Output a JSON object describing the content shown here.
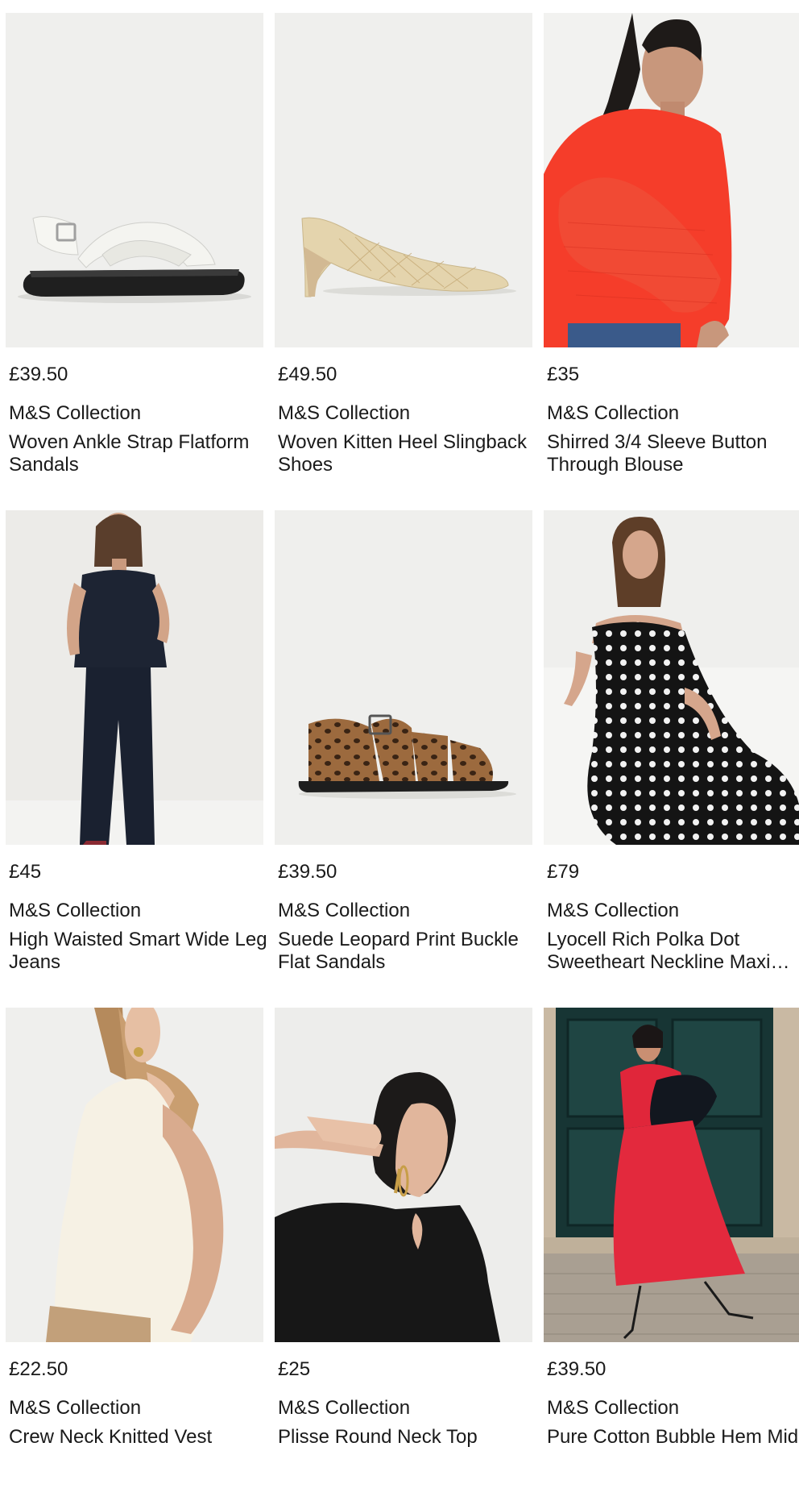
{
  "products": [
    {
      "price": "£39.50",
      "brand": "M&S Collection",
      "name": "Woven Ankle Strap Flatform Sandals",
      "image": "white-woven-flatform-sandal"
    },
    {
      "price": "£49.50",
      "brand": "M&S Collection",
      "name": "Woven Kitten Heel Slingback Shoes",
      "image": "beige-woven-kitten-heel-slingback"
    },
    {
      "price": "£35",
      "brand": "M&S Collection",
      "name": "Shirred 3/4 Sleeve Button Through Blouse",
      "image": "model-red-shirred-blouse"
    },
    {
      "price": "£45",
      "brand": "M&S Collection",
      "name": "High Waisted Smart Wide Leg Jeans",
      "image": "model-dark-denim-waistcoat-jeans"
    },
    {
      "price": "£39.50",
      "brand": "M&S Collection",
      "name": "Suede Leopard Print Buckle Flat Sandals",
      "image": "leopard-print-fisherman-sandal"
    },
    {
      "price": "£79",
      "brand": "M&S Collection",
      "name": "Lyocell Rich Polka Dot Sweetheart Neckline Maxi…",
      "image": "model-black-polka-dot-maxi-dress"
    },
    {
      "price": "£22.50",
      "brand": "M&S Collection",
      "name": "Crew Neck Knitted Vest",
      "image": "model-cream-knitted-vest"
    },
    {
      "price": "£25",
      "brand": "M&S Collection",
      "name": "Plisse Round Neck Top",
      "image": "model-black-plisse-top"
    },
    {
      "price": "£39.50",
      "brand": "M&S Collection",
      "name": "Pure Cotton Bubble Hem Midi",
      "image": "model-red-bubble-hem-midi"
    }
  ]
}
